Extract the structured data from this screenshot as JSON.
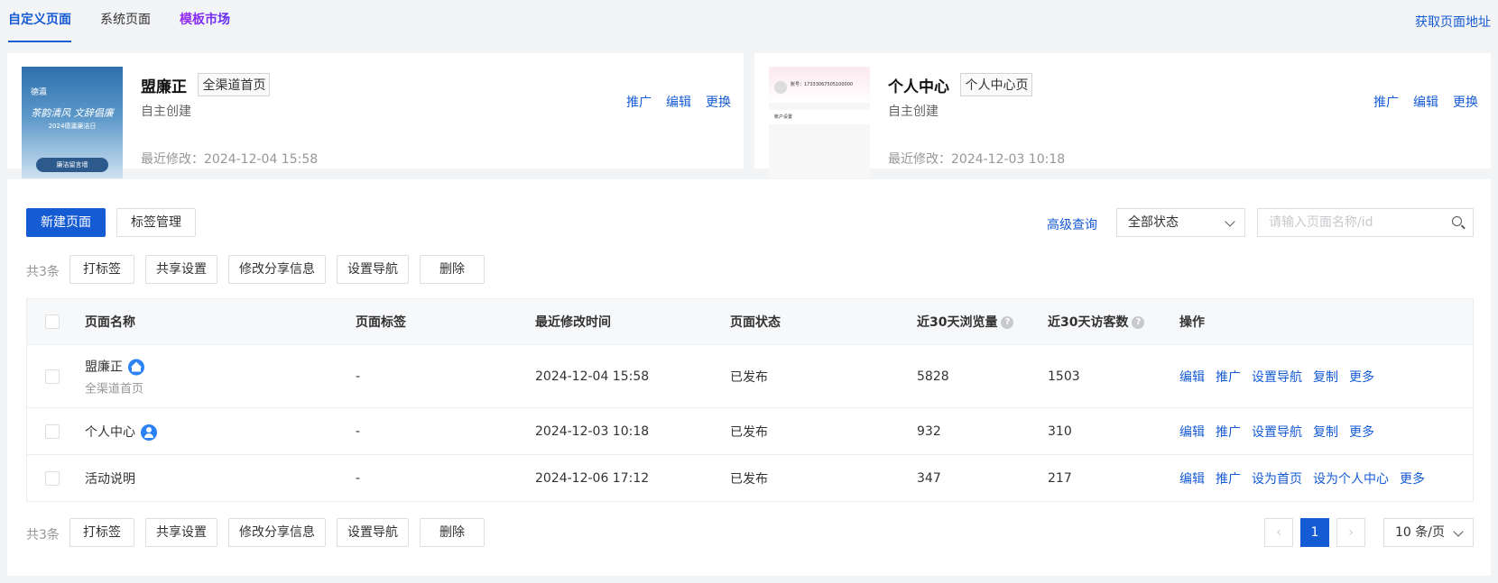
{
  "tabs": [
    {
      "label": "自定义页面"
    },
    {
      "label": "系统页面"
    },
    {
      "label": "模板市场"
    }
  ],
  "get_url_label": "获取页面地址",
  "cards": [
    {
      "name": "盟廉正",
      "tag": "全渠道首页",
      "origin": "自主创建",
      "modified_label": "最近修改：",
      "modified": "2024-12-04 15:58",
      "actions": [
        "推广",
        "编辑",
        "更换"
      ],
      "thumb": {
        "brand": "德瀛",
        "slogan": "茶韵清风 文辞倡廉",
        "subtitle": "2024德瀛廉洁日",
        "pill": "廉洁留言墙"
      }
    },
    {
      "name": "个人中心",
      "tag": "个人中心页",
      "origin": "自主创建",
      "modified_label": "最近修改：",
      "modified": "2024-12-03 10:18",
      "actions": [
        "推广",
        "编辑",
        "更换"
      ],
      "thumb": {
        "phone": "账号：17333067505100000",
        "row": "帐户设置"
      }
    }
  ],
  "toolbar": {
    "new_page": "新建页面",
    "tag_manage": "标签管理",
    "advanced": "高级查询",
    "status_select": "全部状态",
    "search_placeholder": "请输入页面名称/id"
  },
  "bulk": {
    "total": "共3条",
    "actions": [
      "打标签",
      "共享设置",
      "修改分享信息",
      "设置导航",
      "删除"
    ]
  },
  "table": {
    "headers": [
      "页面名称",
      "页面标签",
      "最近修改时间",
      "页面状态",
      "近30天浏览量",
      "近30天访客数",
      "操作"
    ],
    "rows": [
      {
        "name": "盟廉正",
        "sub": "全渠道首页",
        "icon": "home-icon",
        "tag": "-",
        "time": "2024-12-04 15:58",
        "status": "已发布",
        "views": "5828",
        "visitors": "1503",
        "ops": [
          "编辑",
          "推广",
          "设置导航",
          "复制",
          "更多"
        ]
      },
      {
        "name": "个人中心",
        "sub": "",
        "icon": "user-icon",
        "tag": "-",
        "time": "2024-12-03 10:18",
        "status": "已发布",
        "views": "932",
        "visitors": "310",
        "ops": [
          "编辑",
          "推广",
          "设置导航",
          "复制",
          "更多"
        ]
      },
      {
        "name": "活动说明",
        "sub": "",
        "icon": "",
        "tag": "-",
        "time": "2024-12-06 17:12",
        "status": "已发布",
        "views": "347",
        "visitors": "217",
        "ops": [
          "编辑",
          "推广",
          "设为首页",
          "设为个人中心",
          "更多"
        ]
      }
    ]
  },
  "pagination": {
    "prev": "‹",
    "current": "1",
    "next": "›",
    "page_size": "10 条/页"
  },
  "colors": {
    "primary": "#155bd4",
    "market": "#7a1cf0"
  }
}
